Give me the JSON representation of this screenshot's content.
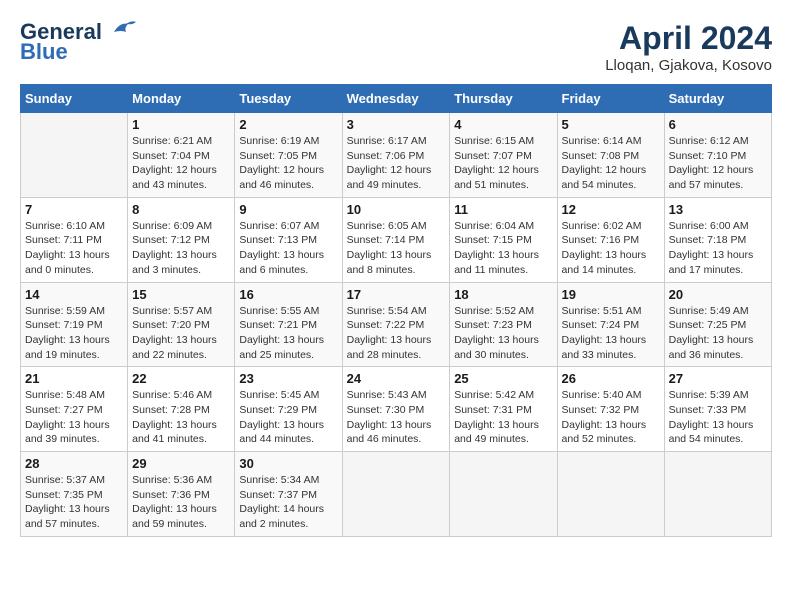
{
  "header": {
    "logo_general": "General",
    "logo_blue": "Blue",
    "title": "April 2024",
    "subtitle": "Lloqan, Gjakova, Kosovo"
  },
  "calendar": {
    "days_of_week": [
      "Sunday",
      "Monday",
      "Tuesday",
      "Wednesday",
      "Thursday",
      "Friday",
      "Saturday"
    ],
    "weeks": [
      [
        {
          "day": "",
          "info": ""
        },
        {
          "day": "1",
          "info": "Sunrise: 6:21 AM\nSunset: 7:04 PM\nDaylight: 12 hours\nand 43 minutes."
        },
        {
          "day": "2",
          "info": "Sunrise: 6:19 AM\nSunset: 7:05 PM\nDaylight: 12 hours\nand 46 minutes."
        },
        {
          "day": "3",
          "info": "Sunrise: 6:17 AM\nSunset: 7:06 PM\nDaylight: 12 hours\nand 49 minutes."
        },
        {
          "day": "4",
          "info": "Sunrise: 6:15 AM\nSunset: 7:07 PM\nDaylight: 12 hours\nand 51 minutes."
        },
        {
          "day": "5",
          "info": "Sunrise: 6:14 AM\nSunset: 7:08 PM\nDaylight: 12 hours\nand 54 minutes."
        },
        {
          "day": "6",
          "info": "Sunrise: 6:12 AM\nSunset: 7:10 PM\nDaylight: 12 hours\nand 57 minutes."
        }
      ],
      [
        {
          "day": "7",
          "info": "Sunrise: 6:10 AM\nSunset: 7:11 PM\nDaylight: 13 hours\nand 0 minutes."
        },
        {
          "day": "8",
          "info": "Sunrise: 6:09 AM\nSunset: 7:12 PM\nDaylight: 13 hours\nand 3 minutes."
        },
        {
          "day": "9",
          "info": "Sunrise: 6:07 AM\nSunset: 7:13 PM\nDaylight: 13 hours\nand 6 minutes."
        },
        {
          "day": "10",
          "info": "Sunrise: 6:05 AM\nSunset: 7:14 PM\nDaylight: 13 hours\nand 8 minutes."
        },
        {
          "day": "11",
          "info": "Sunrise: 6:04 AM\nSunset: 7:15 PM\nDaylight: 13 hours\nand 11 minutes."
        },
        {
          "day": "12",
          "info": "Sunrise: 6:02 AM\nSunset: 7:16 PM\nDaylight: 13 hours\nand 14 minutes."
        },
        {
          "day": "13",
          "info": "Sunrise: 6:00 AM\nSunset: 7:18 PM\nDaylight: 13 hours\nand 17 minutes."
        }
      ],
      [
        {
          "day": "14",
          "info": "Sunrise: 5:59 AM\nSunset: 7:19 PM\nDaylight: 13 hours\nand 19 minutes."
        },
        {
          "day": "15",
          "info": "Sunrise: 5:57 AM\nSunset: 7:20 PM\nDaylight: 13 hours\nand 22 minutes."
        },
        {
          "day": "16",
          "info": "Sunrise: 5:55 AM\nSunset: 7:21 PM\nDaylight: 13 hours\nand 25 minutes."
        },
        {
          "day": "17",
          "info": "Sunrise: 5:54 AM\nSunset: 7:22 PM\nDaylight: 13 hours\nand 28 minutes."
        },
        {
          "day": "18",
          "info": "Sunrise: 5:52 AM\nSunset: 7:23 PM\nDaylight: 13 hours\nand 30 minutes."
        },
        {
          "day": "19",
          "info": "Sunrise: 5:51 AM\nSunset: 7:24 PM\nDaylight: 13 hours\nand 33 minutes."
        },
        {
          "day": "20",
          "info": "Sunrise: 5:49 AM\nSunset: 7:25 PM\nDaylight: 13 hours\nand 36 minutes."
        }
      ],
      [
        {
          "day": "21",
          "info": "Sunrise: 5:48 AM\nSunset: 7:27 PM\nDaylight: 13 hours\nand 39 minutes."
        },
        {
          "day": "22",
          "info": "Sunrise: 5:46 AM\nSunset: 7:28 PM\nDaylight: 13 hours\nand 41 minutes."
        },
        {
          "day": "23",
          "info": "Sunrise: 5:45 AM\nSunset: 7:29 PM\nDaylight: 13 hours\nand 44 minutes."
        },
        {
          "day": "24",
          "info": "Sunrise: 5:43 AM\nSunset: 7:30 PM\nDaylight: 13 hours\nand 46 minutes."
        },
        {
          "day": "25",
          "info": "Sunrise: 5:42 AM\nSunset: 7:31 PM\nDaylight: 13 hours\nand 49 minutes."
        },
        {
          "day": "26",
          "info": "Sunrise: 5:40 AM\nSunset: 7:32 PM\nDaylight: 13 hours\nand 52 minutes."
        },
        {
          "day": "27",
          "info": "Sunrise: 5:39 AM\nSunset: 7:33 PM\nDaylight: 13 hours\nand 54 minutes."
        }
      ],
      [
        {
          "day": "28",
          "info": "Sunrise: 5:37 AM\nSunset: 7:35 PM\nDaylight: 13 hours\nand 57 minutes."
        },
        {
          "day": "29",
          "info": "Sunrise: 5:36 AM\nSunset: 7:36 PM\nDaylight: 13 hours\nand 59 minutes."
        },
        {
          "day": "30",
          "info": "Sunrise: 5:34 AM\nSunset: 7:37 PM\nDaylight: 14 hours\nand 2 minutes."
        },
        {
          "day": "",
          "info": ""
        },
        {
          "day": "",
          "info": ""
        },
        {
          "day": "",
          "info": ""
        },
        {
          "day": "",
          "info": ""
        }
      ]
    ]
  }
}
